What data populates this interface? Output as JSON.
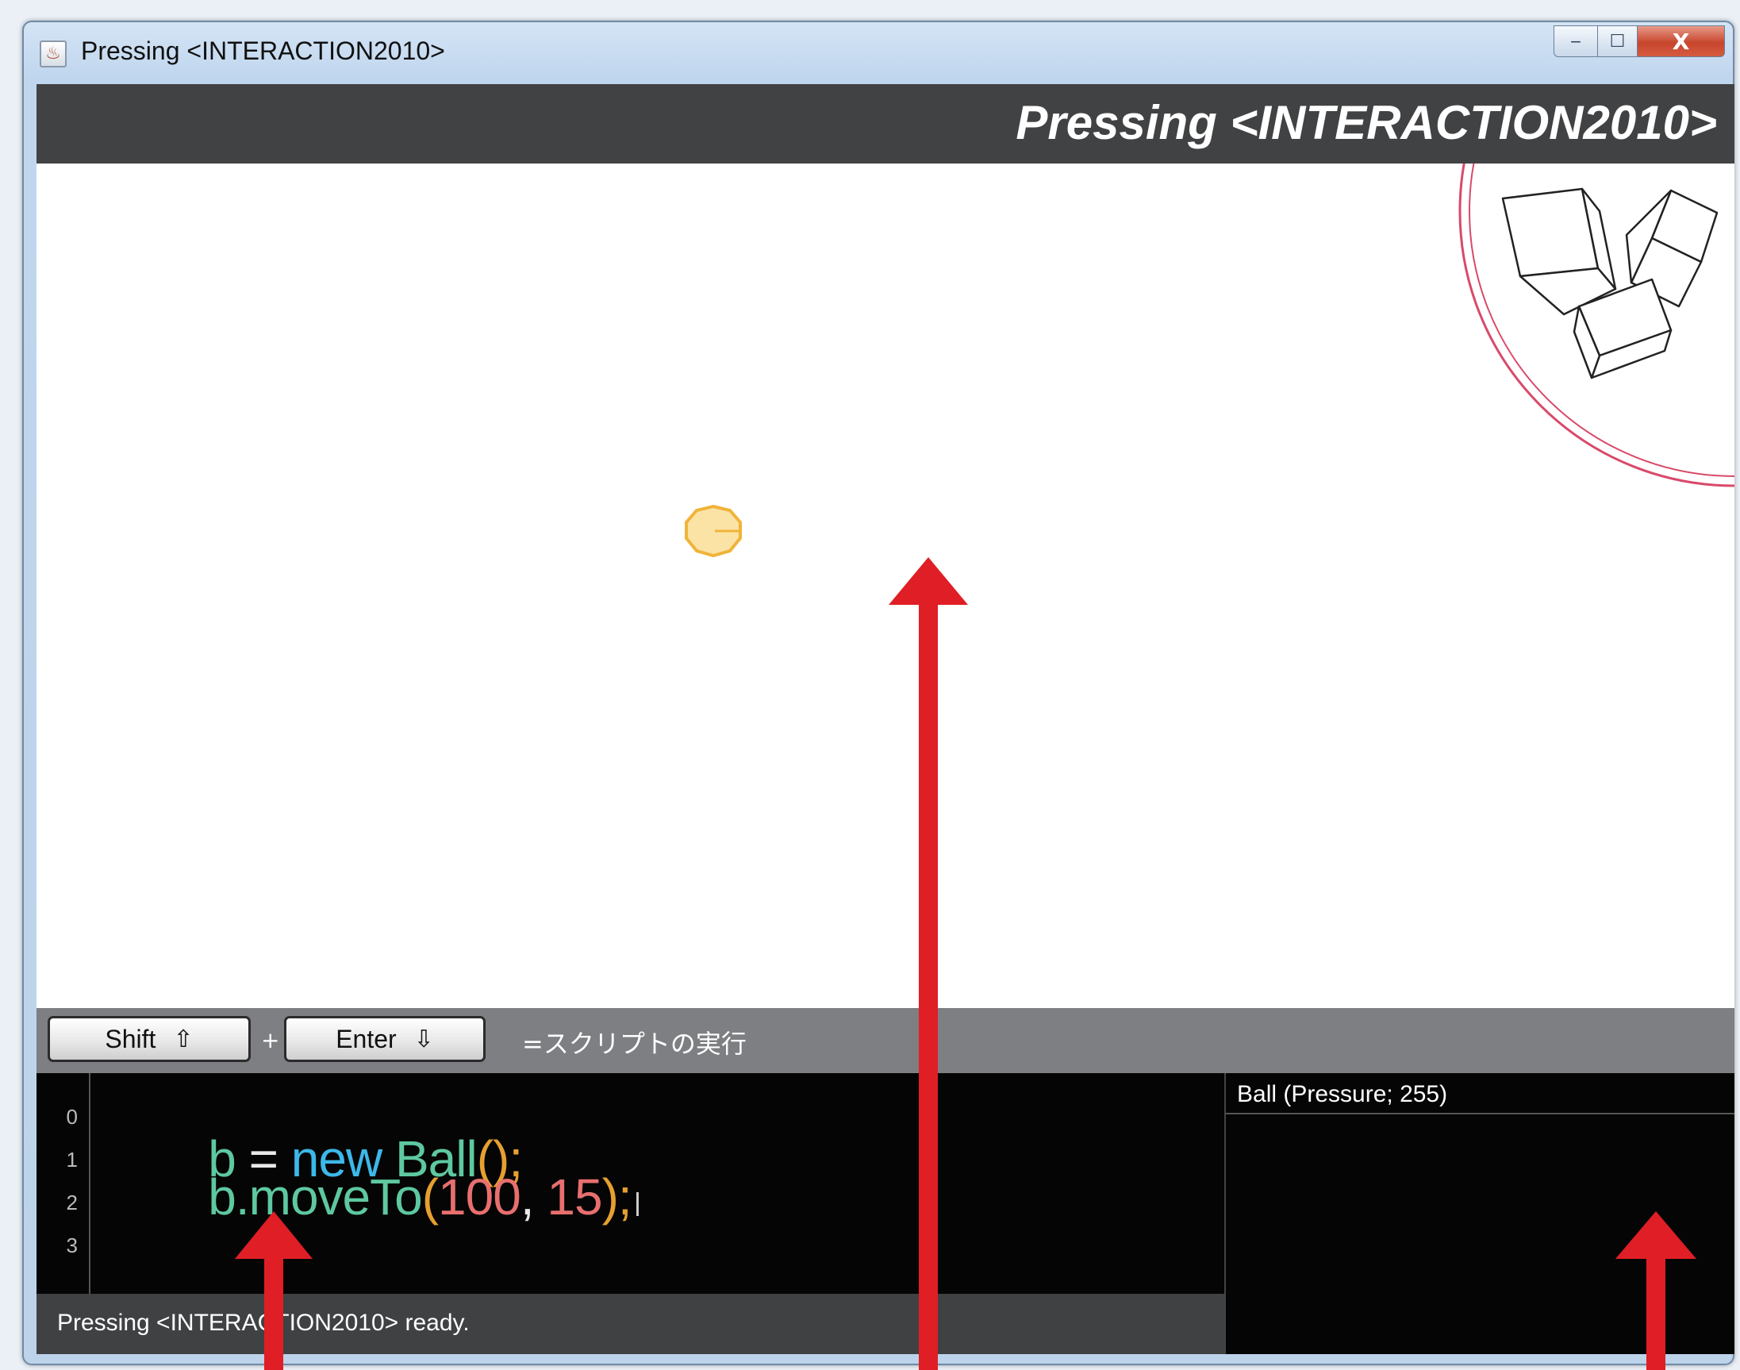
{
  "window": {
    "title": "Pressing <INTERACTION2010>",
    "controls": {
      "minimize": "‒",
      "maximize": "☐",
      "close": "X"
    }
  },
  "header": {
    "title": "Pressing <INTERACTION2010>"
  },
  "keybar": {
    "shift_label": "Shift",
    "shift_glyph": "⇧",
    "plus": "+",
    "enter_label": "Enter",
    "enter_glyph": "⇩",
    "run_label": "=スクリプトの実行"
  },
  "editor": {
    "line_numbers": [
      "0",
      "1",
      "2",
      "3"
    ],
    "lines": [
      [
        {
          "t": "b",
          "c": "var"
        },
        {
          "t": " = ",
          "c": "op"
        },
        {
          "t": "new",
          "c": "kw"
        },
        {
          "t": " ",
          "c": "op"
        },
        {
          "t": "Ball",
          "c": "cls"
        },
        {
          "t": "()",
          "c": "paren"
        },
        {
          "t": ";",
          "c": "semi"
        }
      ],
      [
        {
          "t": "b.moveTo",
          "c": "var"
        },
        {
          "t": "(",
          "c": "paren"
        },
        {
          "t": "100",
          "c": "num"
        },
        {
          "t": ", ",
          "c": "op"
        },
        {
          "t": "15",
          "c": "num"
        },
        {
          "t": ");",
          "c": "paren"
        }
      ]
    ]
  },
  "status": {
    "text": "Pressing <INTERACTION2010> ready."
  },
  "object_panel": {
    "entry": "Ball (Pressure; 255)"
  },
  "colors": {
    "header_bg": "#414244",
    "keybar_bg": "#7d7f82",
    "editor_bg": "#050505",
    "ball_fill": "#fbe3a6",
    "ball_stroke": "#f0b43a",
    "circle_stroke": "#d84a6a",
    "arrow": "#e01e25"
  }
}
